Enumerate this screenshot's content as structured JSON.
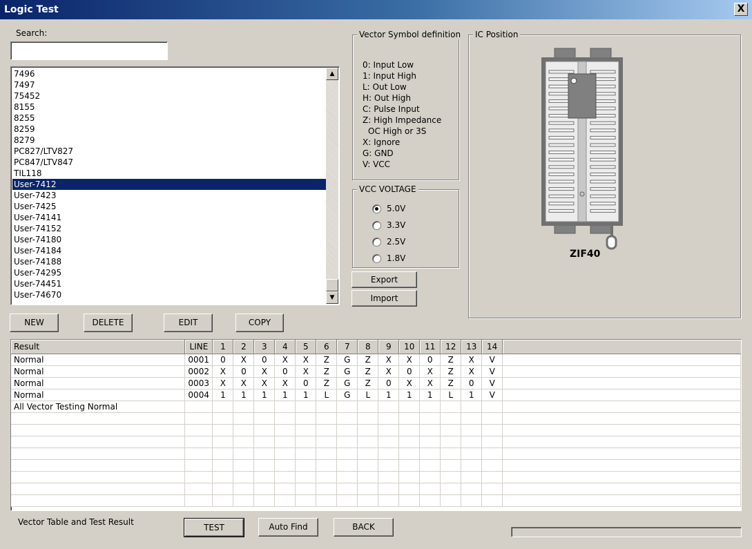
{
  "window": {
    "title": "Logic Test",
    "close_label": "X"
  },
  "search": {
    "label": "Search:",
    "value": ""
  },
  "chip_list": {
    "items": [
      "7496",
      "7497",
      "75452",
      "8155",
      "8255",
      "8259",
      "8279",
      "PC827/LTV827",
      "PC847/LTV847",
      "TIL118",
      "User-7412",
      "User-7423",
      "User-7425",
      "User-74141",
      "User-74152",
      "User-74180",
      "User-74184",
      "User-74188",
      "User-74295",
      "User-74451",
      "User-74670"
    ],
    "selected_index": 10
  },
  "list_buttons": {
    "new": "NEW",
    "delete": "DELETE",
    "edit": "EDIT",
    "copy": "COPY"
  },
  "vector_symbols": {
    "title": "Vector Symbol definition",
    "lines": [
      "0: Input Low",
      "1: Input High",
      "L: Out Low",
      "H: Out High",
      "C: Pulse Input",
      "Z: High Impedance",
      "OC High or 3S",
      "X: Ignore",
      "G: GND",
      "V: VCC"
    ]
  },
  "vcc": {
    "title": "VCC VOLTAGE",
    "options": [
      "5.0V",
      "3.3V",
      "2.5V",
      "1.8V"
    ],
    "selected_index": 0
  },
  "io_buttons": {
    "export": "Export",
    "import": "Import"
  },
  "ic_position": {
    "title": "IC Position",
    "socket_label": "ZIF40"
  },
  "table": {
    "columns": [
      "Result",
      "LINE",
      "1",
      "2",
      "3",
      "4",
      "5",
      "6",
      "7",
      "8",
      "9",
      "10",
      "11",
      "12",
      "13",
      "14"
    ],
    "rows": [
      [
        "Normal",
        "0001",
        "0",
        "X",
        "0",
        "X",
        "X",
        "Z",
        "G",
        "Z",
        "X",
        "X",
        "0",
        "Z",
        "X",
        "V"
      ],
      [
        "Normal",
        "0002",
        "X",
        "0",
        "X",
        "0",
        "X",
        "Z",
        "G",
        "Z",
        "X",
        "0",
        "X",
        "Z",
        "X",
        "V"
      ],
      [
        "Normal",
        "0003",
        "X",
        "X",
        "X",
        "X",
        "0",
        "Z",
        "G",
        "Z",
        "0",
        "X",
        "X",
        "Z",
        "0",
        "V"
      ],
      [
        "Normal",
        "0004",
        "1",
        "1",
        "1",
        "1",
        "1",
        "L",
        "G",
        "L",
        "1",
        "1",
        "1",
        "L",
        "1",
        "V"
      ],
      [
        "All Vector Testing Normal",
        "",
        "",
        "",
        "",
        "",
        "",
        "",
        "",
        "",
        "",
        "",
        "",
        "",
        "",
        ""
      ]
    ],
    "empty_rows": 8
  },
  "footer": {
    "caption": "Vector Table and Test Result",
    "test": "TEST",
    "auto_find": "Auto Find",
    "back": "BACK",
    "progress": 0
  }
}
